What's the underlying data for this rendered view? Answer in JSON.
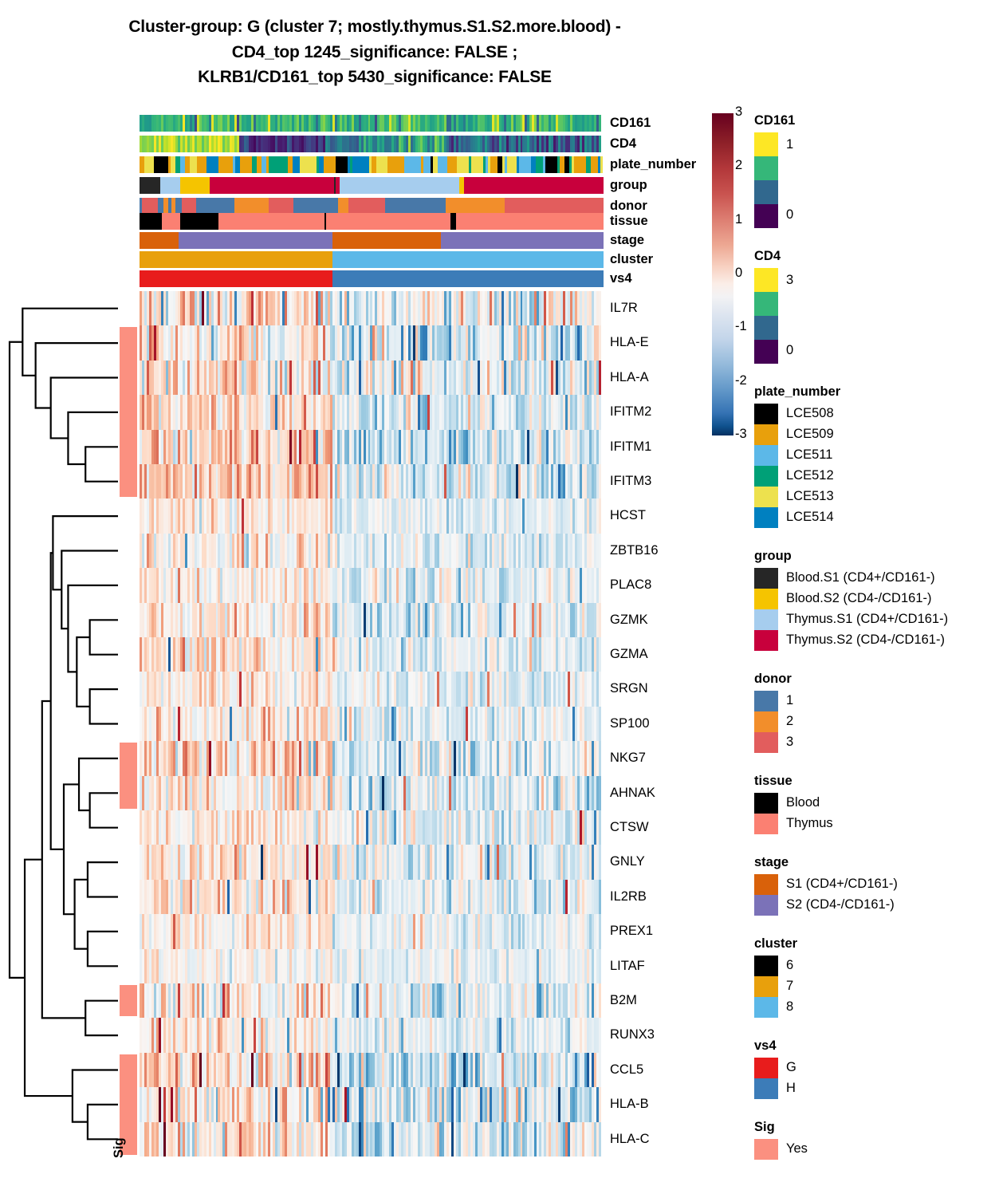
{
  "title": {
    "line1": "Cluster-group: G (cluster 7; mostly.thymus.S1.S2.more.blood) -",
    "line2": "CD4_top 1245_significance: FALSE ;",
    "line3": "KLRB1/CD161_top 5430_significance: FALSE"
  },
  "annotations": {
    "rows": [
      {
        "name": "CD161",
        "type": "continuous-viridis"
      },
      {
        "name": "CD4",
        "type": "continuous-viridis"
      },
      {
        "name": "plate_number",
        "type": "categorical"
      },
      {
        "name": "group",
        "type": "categorical"
      },
      {
        "name": "donor",
        "type": "categorical"
      },
      {
        "name": "tissue",
        "type": "categorical"
      },
      {
        "name": "stage",
        "type": "categorical"
      },
      {
        "name": "cluster",
        "type": "categorical"
      },
      {
        "name": "vs4",
        "type": "categorical"
      }
    ]
  },
  "genes": [
    "IL7R",
    "HLA-E",
    "HLA-A",
    "IFITM2",
    "IFITM1",
    "IFITM3",
    "HCST",
    "ZBTB16",
    "PLAC8",
    "GZMK",
    "GZMA",
    "SRGN",
    "SP100",
    "NKG7",
    "AHNAK",
    "CTSW",
    "GNLY",
    "IL2RB",
    "PREX1",
    "LITAF",
    "B2M",
    "RUNX3",
    "CCL5",
    "HLA-B",
    "HLA-C"
  ],
  "sig_column": {
    "label": "Sig",
    "significant_genes": [
      "HLA-E",
      "HLA-A",
      "IFITM2",
      "IFITM1",
      "IFITM3",
      "NKG7",
      "AHNAK",
      "B2M",
      "CCL5",
      "HLA-B",
      "HLA-C"
    ],
    "color": "#FB9080"
  },
  "colorbar": {
    "ticks": [
      "3",
      "2",
      "1",
      "0",
      "-1",
      "-2",
      "-3"
    ],
    "max": 3,
    "min": -3,
    "high_color": "#67001f",
    "mid_color": "#f7f7f7",
    "low_color": "#053061"
  },
  "legends": [
    {
      "title": "CD161",
      "type": "continuous",
      "top_label": "1",
      "bottom_label": "0",
      "colors": [
        "#FDE725",
        "#35B779",
        "#31688E",
        "#440154"
      ]
    },
    {
      "title": "CD4",
      "type": "continuous",
      "top_label": "3",
      "bottom_label": "0",
      "colors": [
        "#FDE725",
        "#35B779",
        "#31688E",
        "#440154"
      ]
    },
    {
      "title": "plate_number",
      "type": "discrete",
      "items": [
        {
          "label": "LCE508",
          "color": "#000000"
        },
        {
          "label": "LCE509",
          "color": "#E8A00C"
        },
        {
          "label": "LCE511",
          "color": "#5CB8E8"
        },
        {
          "label": "LCE512",
          "color": "#00A077"
        },
        {
          "label": "LCE513",
          "color": "#EDE14E"
        },
        {
          "label": "LCE514",
          "color": "#0080C0"
        }
      ]
    },
    {
      "title": "group",
      "type": "discrete",
      "items": [
        {
          "label": "Blood.S1 (CD4+/CD161-)",
          "color": "#262626"
        },
        {
          "label": "Blood.S2 (CD4-/CD161-)",
          "color": "#F5C400"
        },
        {
          "label": "Thymus.S1 (CD4+/CD161-)",
          "color": "#A6CDEE"
        },
        {
          "label": "Thymus.S2 (CD4-/CD161-)",
          "color": "#C8003C"
        }
      ]
    },
    {
      "title": "donor",
      "type": "discrete",
      "items": [
        {
          "label": "1",
          "color": "#4878A8"
        },
        {
          "label": "2",
          "color": "#F28E2B"
        },
        {
          "label": "3",
          "color": "#E25D5D"
        }
      ]
    },
    {
      "title": "tissue",
      "type": "discrete",
      "items": [
        {
          "label": "Blood",
          "color": "#000000"
        },
        {
          "label": "Thymus",
          "color": "#FB8072"
        }
      ]
    },
    {
      "title": "stage",
      "type": "discrete",
      "items": [
        {
          "label": "S1 (CD4+/CD161-)",
          "color": "#D9610A"
        },
        {
          "label": "S2 (CD4-/CD161-)",
          "color": "#7B72B8"
        }
      ]
    },
    {
      "title": "cluster",
      "type": "discrete",
      "items": [
        {
          "label": "6",
          "color": "#000000"
        },
        {
          "label": "7",
          "color": "#E8A00C"
        },
        {
          "label": "8",
          "color": "#5CB8E8"
        }
      ]
    },
    {
      "title": "vs4",
      "type": "discrete",
      "items": [
        {
          "label": "G",
          "color": "#E81C1C"
        },
        {
          "label": "H",
          "color": "#3C7CB8"
        }
      ]
    },
    {
      "title": "Sig",
      "type": "discrete",
      "items": [
        {
          "label": "Yes",
          "color": "#FB9080"
        }
      ]
    }
  ],
  "chart_data": {
    "type": "heatmap",
    "title": "Cluster-group: G (cluster 7; mostly.thymus.S1.S2.more.blood) - CD4_top 1245_significance: FALSE ; KLRB1/CD161_top 5430_significance: FALSE",
    "rows": [
      "IL7R",
      "HLA-E",
      "HLA-A",
      "IFITM2",
      "IFITM1",
      "IFITM3",
      "HCST",
      "ZBTB16",
      "PLAC8",
      "GZMK",
      "GZMA",
      "SRGN",
      "SP100",
      "NKG7",
      "AHNAK",
      "CTSW",
      "GNLY",
      "IL2RB",
      "PREX1",
      "LITAF",
      "B2M",
      "RUNX3",
      "CCL5",
      "HLA-B",
      "HLA-C"
    ],
    "n_columns": 194,
    "value_range": [
      -3,
      3
    ],
    "colormap": "RdBu_r",
    "row_dendrogram": true,
    "column_dendrogram": false,
    "xlabel": "",
    "ylabel": "",
    "row_annotation": "Sig",
    "column_annotations": [
      "CD161",
      "CD4",
      "plate_number",
      "group",
      "donor",
      "tissue",
      "stage",
      "cluster",
      "vs4"
    ]
  }
}
